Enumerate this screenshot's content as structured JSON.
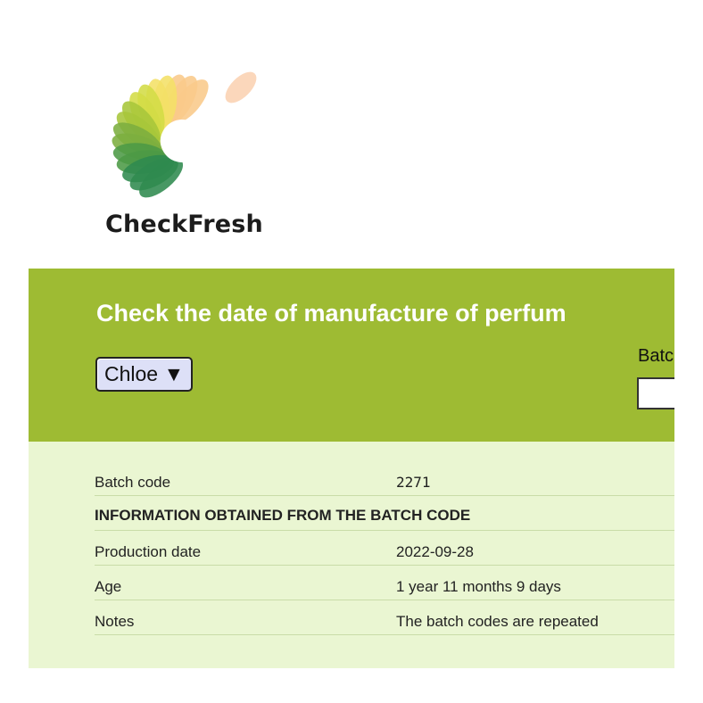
{
  "logo": {
    "name": "CheckFresh",
    "icon": "flower-c-logo-icon",
    "colors": [
      "#f9c98a",
      "#f4e066",
      "#d3dc46",
      "#a7c63a",
      "#7cae3f",
      "#4c9a45",
      "#2f8a4f"
    ]
  },
  "header": {
    "title": "Check the date of manufacture of perfum",
    "background": "#9ebb33"
  },
  "brand_select": {
    "value": "Chloe",
    "arrow": "▼"
  },
  "batch": {
    "label": "Batc",
    "input_value": ""
  },
  "results": {
    "background": "#eaf6d2",
    "rows": [
      {
        "label": "Batch code",
        "value": "2271"
      },
      {
        "label": "INFORMATION OBTAINED FROM THE BATCH CODE",
        "value": ""
      },
      {
        "label": "Production date",
        "value": "2022-09-28"
      },
      {
        "label": "Age",
        "value": "1 year 11 months 9 days"
      },
      {
        "label": "Notes",
        "value": "The batch codes are repeated"
      }
    ]
  }
}
